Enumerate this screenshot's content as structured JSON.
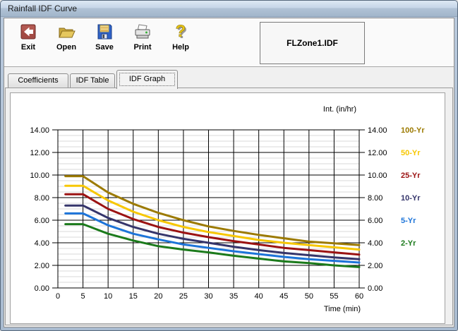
{
  "window": {
    "title": "Rainfall IDF Curve"
  },
  "toolbar": {
    "buttons": [
      {
        "icon": "exit-icon",
        "label": "Exit"
      },
      {
        "icon": "open-icon",
        "label": "Open"
      },
      {
        "icon": "save-icon",
        "label": "Save"
      },
      {
        "icon": "print-icon",
        "label": "Print"
      },
      {
        "icon": "help-icon",
        "label": "Help"
      }
    ],
    "filename": "FLZone1.IDF"
  },
  "tabs": [
    {
      "label": "Coefficients",
      "active": false
    },
    {
      "label": "IDF Table",
      "active": false
    },
    {
      "label": "IDF Graph",
      "active": true
    }
  ],
  "chart_data": {
    "type": "line",
    "title": "",
    "xlabel": "Time (min)",
    "ylabel": "Int. (in/hr)",
    "xlim": [
      0,
      60
    ],
    "ylim": [
      0,
      14
    ],
    "x_tick_step": 5,
    "y_major_step": 2,
    "y_minor_step": 0.5,
    "grid": true,
    "legend_position": "right",
    "x": [
      1.5,
      5,
      10,
      15,
      20,
      25,
      30,
      35,
      40,
      45,
      50,
      55,
      60
    ],
    "series": [
      {
        "name": "100-Yr",
        "color": "#9c7a00",
        "values": [
          9.9,
          9.9,
          8.45,
          7.45,
          6.65,
          6.0,
          5.45,
          5.05,
          4.7,
          4.4,
          4.1,
          3.95,
          3.8
        ]
      },
      {
        "name": "50-Yr",
        "color": "#f7c700",
        "values": [
          9.05,
          9.05,
          7.75,
          6.75,
          6.0,
          5.4,
          4.95,
          4.6,
          4.25,
          4.0,
          3.8,
          3.6,
          3.4
        ]
      },
      {
        "name": "25-Yr",
        "color": "#9b1212",
        "values": [
          8.3,
          8.3,
          7.0,
          6.1,
          5.4,
          4.9,
          4.5,
          4.15,
          3.85,
          3.55,
          3.35,
          3.15,
          2.95
        ]
      },
      {
        "name": "10-Yr",
        "color": "#35356b",
        "values": [
          7.3,
          7.3,
          6.2,
          5.4,
          4.8,
          4.35,
          4.0,
          3.65,
          3.35,
          3.1,
          2.9,
          2.7,
          2.55
        ]
      },
      {
        "name": "5-Yr",
        "color": "#1c74d9",
        "values": [
          6.6,
          6.6,
          5.55,
          4.8,
          4.3,
          3.85,
          3.55,
          3.25,
          3.0,
          2.75,
          2.55,
          2.4,
          2.25
        ]
      },
      {
        "name": "2-Yr",
        "color": "#1b7a1b",
        "values": [
          5.65,
          5.65,
          4.8,
          4.2,
          3.7,
          3.4,
          3.15,
          2.85,
          2.6,
          2.35,
          2.2,
          2.0,
          1.85
        ]
      }
    ],
    "axis_colors": {
      "major_grid": "#000000",
      "minor_grid": "#d9d9d9",
      "labels": "#000000"
    }
  }
}
